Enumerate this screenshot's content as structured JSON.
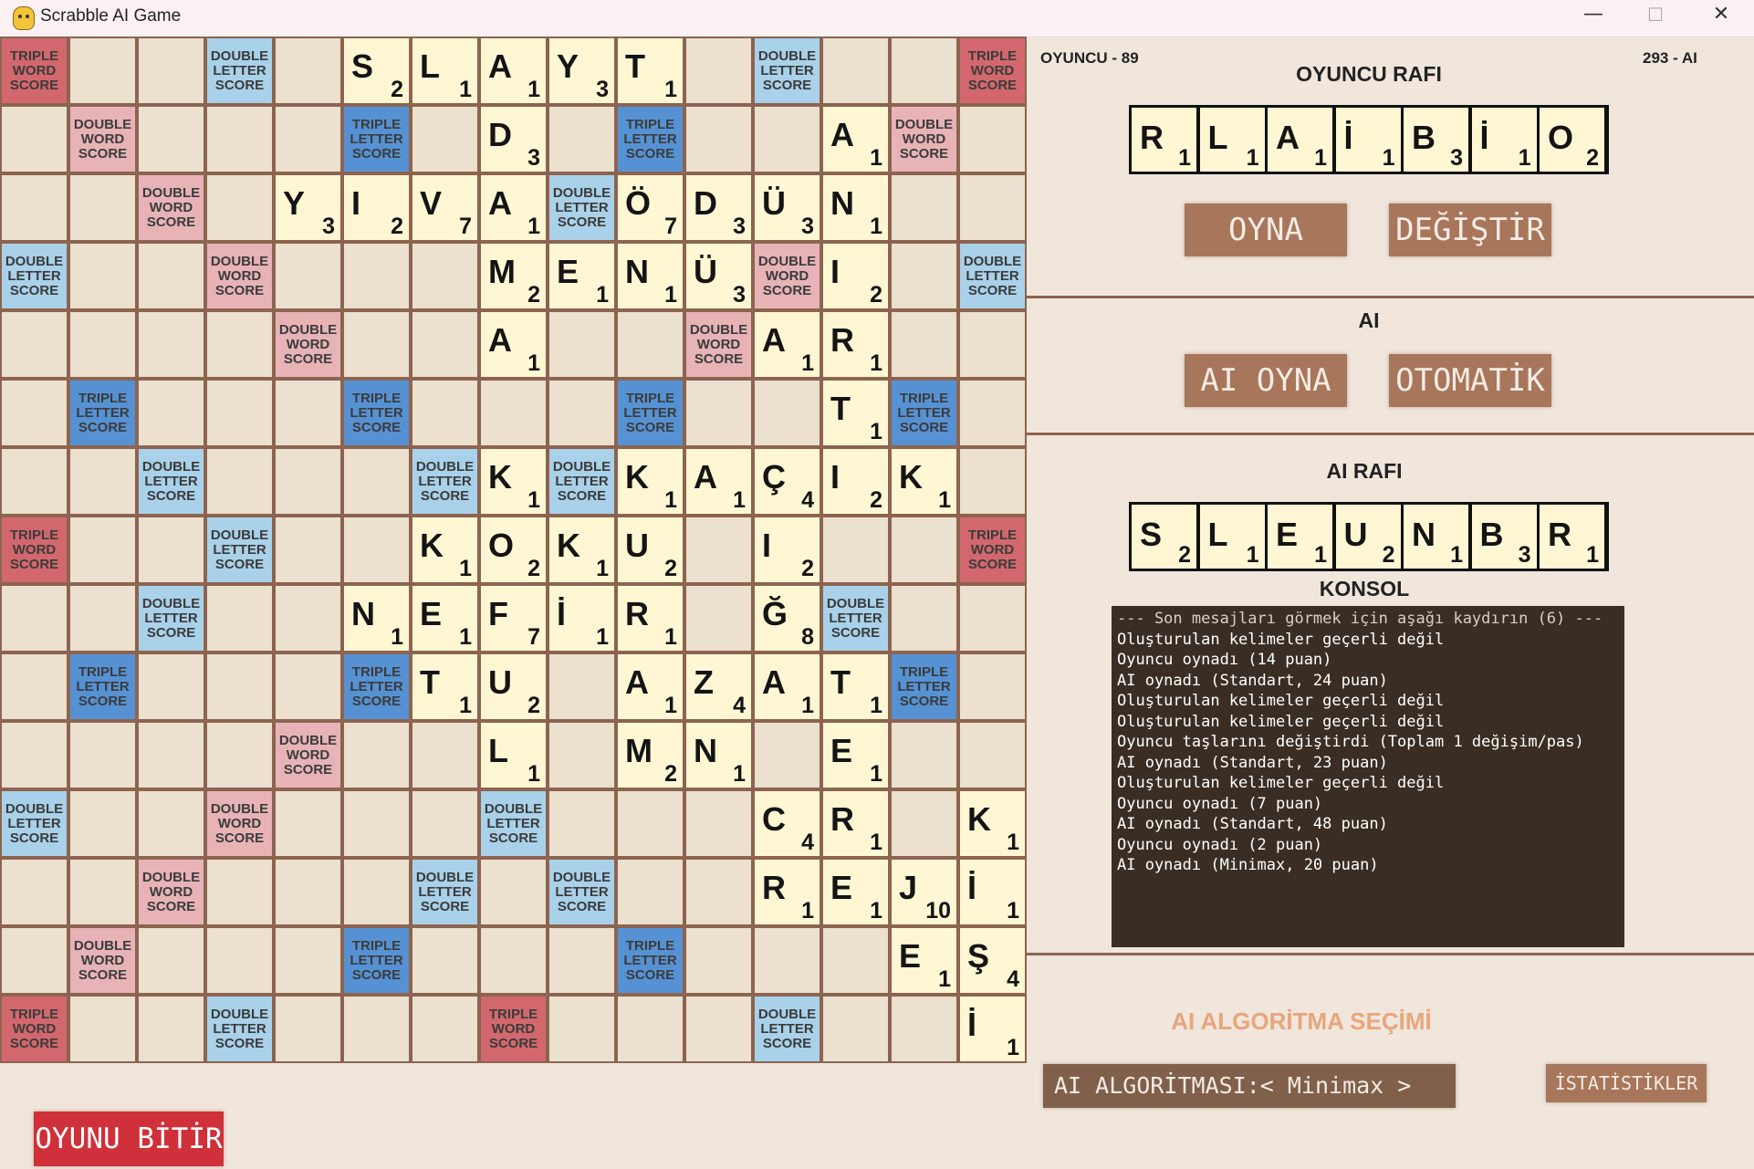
{
  "window": {
    "title": "Scrabble AI Game",
    "minimize": "—",
    "maximize": "☐",
    "close": "✕"
  },
  "premium_labels": {
    "TW": "TRIPLE\nWORD\nSCORE",
    "DW": "DOUBLE\nWORD\nSCORE",
    "TL": "TRIPLE\nLETTER\nSCORE",
    "DL": "DOUBLE\nLETTER\nSCORE"
  },
  "board": {
    "premiums": [
      "TW . . DL . . . . . . . DL . . TW",
      ". DW . . . TL . . . TL . . . DW .",
      ". . DW . . . . . DL . . . . . .",
      "DL . . DW . . . . . . . DW . . DL",
      ". . . . DW . . . . . DW . . . .",
      ". TL . . . TL . . . TL . . . TL .",
      ". . DL . . . DL . DL . . . . . .",
      "TW . . DL . . . . . . . . . . TW",
      ". . DL . . . . . . . . . DL . .",
      ". TL . . . TL . . . . . . . TL .",
      ". . . . DW . . . . . . . . . .",
      "DL . . DW . . . DL . . . . . . .",
      ". . DW . . . DL . DL . . . . . .",
      ". DW . . . TL . . . TL . . . . .",
      "TW . . DL . . . TW . . . DL . . ."
    ],
    "tiles": [
      {
        "r": 0,
        "c": 5,
        "l": "S",
        "p": 2
      },
      {
        "r": 0,
        "c": 6,
        "l": "L",
        "p": 1
      },
      {
        "r": 0,
        "c": 7,
        "l": "A",
        "p": 1
      },
      {
        "r": 0,
        "c": 8,
        "l": "Y",
        "p": 3
      },
      {
        "r": 0,
        "c": 9,
        "l": "T",
        "p": 1
      },
      {
        "r": 1,
        "c": 7,
        "l": "D",
        "p": 3
      },
      {
        "r": 1,
        "c": 12,
        "l": "A",
        "p": 1
      },
      {
        "r": 2,
        "c": 4,
        "l": "Y",
        "p": 3
      },
      {
        "r": 2,
        "c": 5,
        "l": "I",
        "p": 2
      },
      {
        "r": 2,
        "c": 6,
        "l": "V",
        "p": 7
      },
      {
        "r": 2,
        "c": 7,
        "l": "A",
        "p": 1
      },
      {
        "r": 2,
        "c": 9,
        "l": "Ö",
        "p": 7
      },
      {
        "r": 2,
        "c": 10,
        "l": "D",
        "p": 3
      },
      {
        "r": 2,
        "c": 11,
        "l": "Ü",
        "p": 3
      },
      {
        "r": 2,
        "c": 12,
        "l": "N",
        "p": 1
      },
      {
        "r": 3,
        "c": 7,
        "l": "M",
        "p": 2
      },
      {
        "r": 3,
        "c": 8,
        "l": "E",
        "p": 1
      },
      {
        "r": 3,
        "c": 9,
        "l": "N",
        "p": 1
      },
      {
        "r": 3,
        "c": 10,
        "l": "Ü",
        "p": 3
      },
      {
        "r": 3,
        "c": 12,
        "l": "I",
        "p": 2
      },
      {
        "r": 4,
        "c": 7,
        "l": "A",
        "p": 1
      },
      {
        "r": 4,
        "c": 11,
        "l": "A",
        "p": 1
      },
      {
        "r": 4,
        "c": 12,
        "l": "R",
        "p": 1
      },
      {
        "r": 5,
        "c": 12,
        "l": "T",
        "p": 1
      },
      {
        "r": 6,
        "c": 7,
        "l": "K",
        "p": 1
      },
      {
        "r": 6,
        "c": 9,
        "l": "K",
        "p": 1
      },
      {
        "r": 6,
        "c": 10,
        "l": "A",
        "p": 1
      },
      {
        "r": 6,
        "c": 11,
        "l": "Ç",
        "p": 4
      },
      {
        "r": 6,
        "c": 12,
        "l": "I",
        "p": 2
      },
      {
        "r": 6,
        "c": 13,
        "l": "K",
        "p": 1
      },
      {
        "r": 7,
        "c": 6,
        "l": "K",
        "p": 1
      },
      {
        "r": 7,
        "c": 7,
        "l": "O",
        "p": 2
      },
      {
        "r": 7,
        "c": 8,
        "l": "K",
        "p": 1
      },
      {
        "r": 7,
        "c": 9,
        "l": "U",
        "p": 2
      },
      {
        "r": 7,
        "c": 11,
        "l": "I",
        "p": 2
      },
      {
        "r": 8,
        "c": 5,
        "l": "N",
        "p": 1
      },
      {
        "r": 8,
        "c": 6,
        "l": "E",
        "p": 1
      },
      {
        "r": 8,
        "c": 7,
        "l": "F",
        "p": 7
      },
      {
        "r": 8,
        "c": 8,
        "l": "İ",
        "p": 1
      },
      {
        "r": 8,
        "c": 9,
        "l": "R",
        "p": 1
      },
      {
        "r": 8,
        "c": 11,
        "l": "Ğ",
        "p": 8
      },
      {
        "r": 9,
        "c": 6,
        "l": "T",
        "p": 1
      },
      {
        "r": 9,
        "c": 7,
        "l": "U",
        "p": 2
      },
      {
        "r": 9,
        "c": 9,
        "l": "A",
        "p": 1
      },
      {
        "r": 9,
        "c": 10,
        "l": "Z",
        "p": 4
      },
      {
        "r": 9,
        "c": 11,
        "l": "A",
        "p": 1
      },
      {
        "r": 9,
        "c": 12,
        "l": "T",
        "p": 1
      },
      {
        "r": 10,
        "c": 7,
        "l": "L",
        "p": 1
      },
      {
        "r": 10,
        "c": 9,
        "l": "M",
        "p": 2
      },
      {
        "r": 10,
        "c": 10,
        "l": "N",
        "p": 1
      },
      {
        "r": 10,
        "c": 12,
        "l": "E",
        "p": 1
      },
      {
        "r": 11,
        "c": 11,
        "l": "C",
        "p": 4
      },
      {
        "r": 11,
        "c": 12,
        "l": "R",
        "p": 1
      },
      {
        "r": 11,
        "c": 14,
        "l": "K",
        "p": 1
      },
      {
        "r": 12,
        "c": 11,
        "l": "R",
        "p": 1
      },
      {
        "r": 12,
        "c": 12,
        "l": "E",
        "p": 1
      },
      {
        "r": 12,
        "c": 13,
        "l": "J",
        "p": 10
      },
      {
        "r": 12,
        "c": 14,
        "l": "İ",
        "p": 1
      },
      {
        "r": 13,
        "c": 13,
        "l": "E",
        "p": 1
      },
      {
        "r": 13,
        "c": 14,
        "l": "Ş",
        "p": 4
      },
      {
        "r": 14,
        "c": 14,
        "l": "İ",
        "p": 1
      }
    ]
  },
  "scores": {
    "player": "OYUNCU - 89",
    "ai": "293 - AI"
  },
  "player_rack": {
    "title": "OYUNCU RAFI",
    "tiles": [
      {
        "l": "R",
        "p": 1
      },
      {
        "l": "L",
        "p": 1
      },
      {
        "l": "A",
        "p": 1
      },
      {
        "l": "İ",
        "p": 1
      },
      {
        "l": "B",
        "p": 3
      },
      {
        "l": "İ",
        "p": 1
      },
      {
        "l": "O",
        "p": 2
      }
    ]
  },
  "buttons": {
    "play": "OYNA",
    "exchange": "DEĞİŞTİR",
    "ai_play": "AI OYNA",
    "auto": "OTOMATİK",
    "end_game": "OYUNU BİTİR",
    "stats": "İSTATİSTİKLER"
  },
  "ai_section": {
    "title": "AI"
  },
  "ai_rack": {
    "title": "AI RAFI",
    "tiles": [
      {
        "l": "S",
        "p": 2
      },
      {
        "l": "L",
        "p": 1
      },
      {
        "l": "E",
        "p": 1
      },
      {
        "l": "U",
        "p": 2
      },
      {
        "l": "N",
        "p": 1
      },
      {
        "l": "B",
        "p": 3
      },
      {
        "l": "R",
        "p": 1
      }
    ]
  },
  "console": {
    "title": "KONSOL",
    "lines": [
      "--- Son mesajları görmek için aşağı kaydırın (6) ---",
      "Oluşturulan kelimeler geçerli değil",
      "Oyuncu oynadı (14 puan)",
      "AI oynadı (Standart, 24 puan)",
      "Oluşturulan kelimeler geçerli değil",
      "Oluşturulan kelimeler geçerli değil",
      "Oyuncu taşlarını değiştirdi (Toplam 1 değişim/pas)",
      "AI oynadı (Standart, 23 puan)",
      "Oluşturulan kelimeler geçerli değil",
      "Oyuncu oynadı (7 puan)",
      "AI oynadı (Standart, 48 puan)",
      "Oyuncu oynadı (2 puan)",
      "AI oynadı (Minimax, 20 puan)"
    ]
  },
  "algorithm": {
    "title": "AI ALGORİTMA SEÇİMİ",
    "selector": "AI ALGORİTMASI:< Minimax >"
  },
  "colors": {
    "tw": "#d2686e",
    "dw": "#e7b3b7",
    "tl": "#5692d3",
    "dl": "#a9d1e9",
    "tile": "#fff7d4",
    "button": "#a8765a",
    "end_button": "#d0303a",
    "console_bg": "#3a2e24",
    "algo_title": "#e8a67c"
  }
}
